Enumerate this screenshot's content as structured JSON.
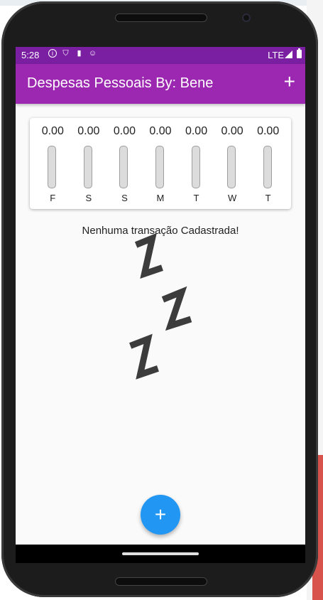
{
  "status_bar": {
    "time": "5:28",
    "network": "LTE",
    "icons": [
      "info-icon",
      "shield-icon",
      "sd-card-icon",
      "face-icon",
      "signal-icon",
      "battery-icon"
    ]
  },
  "app_bar": {
    "title": "Despesas Pessoais By: Bene",
    "add_label": "+"
  },
  "chart_data": {
    "type": "bar",
    "categories": [
      "F",
      "S",
      "S",
      "M",
      "T",
      "W",
      "T"
    ],
    "values": [
      0,
      0,
      0,
      0,
      0,
      0,
      0
    ],
    "value_labels": [
      "0.00",
      "0.00",
      "0.00",
      "0.00",
      "0.00",
      "0.00",
      "0.00"
    ],
    "title": "",
    "xlabel": "",
    "ylabel": ""
  },
  "main": {
    "empty_message": "Nenhuma transação Cadastrada!",
    "empty_art": "zzz-sleep-image"
  },
  "fab": {
    "label": "+"
  },
  "colors": {
    "status_bar": "#7b1fa2",
    "app_bar": "#9c27b0",
    "fab": "#2196f3",
    "bar_track": "#dcdcdc"
  }
}
